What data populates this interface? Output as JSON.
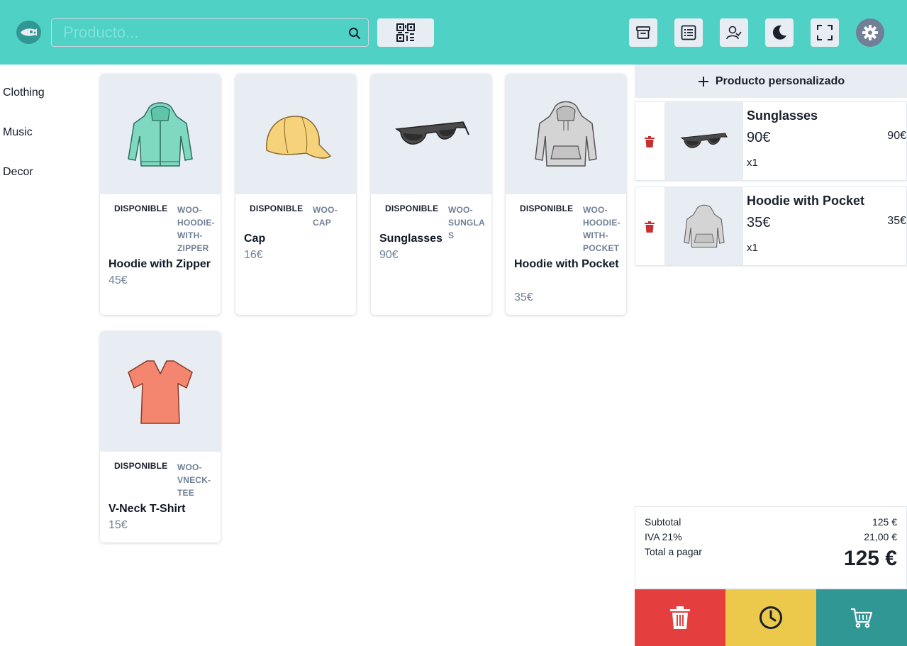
{
  "header": {
    "search_placeholder": "Producto...",
    "icons": [
      "logo-icon",
      "search-icon",
      "qr-code-icon",
      "box-icon",
      "list-icon",
      "customers-icon",
      "moon-icon",
      "fullscreen-icon",
      "gear-icon"
    ]
  },
  "categories": [
    "Clothing",
    "Music",
    "Decor"
  ],
  "products": [
    {
      "status": "DISPONIBLE",
      "sku": "WOO-HOODIE-WITH-ZIPPER",
      "name": "Hoodie with Zipper",
      "price": "45€"
    },
    {
      "status": "DISPONIBLE",
      "sku": "WOO-CAP",
      "name": "Cap",
      "price": "16€"
    },
    {
      "status": "DISPONIBLE",
      "sku": "WOO-SUNGLASSES",
      "name": "Sunglasses",
      "price": "90€"
    },
    {
      "status": "DISPONIBLE",
      "sku": "WOO-HOODIE-WITH-POCKET",
      "name": "Hoodie with Pocket",
      "price": "35€"
    },
    {
      "status": "DISPONIBLE",
      "sku": "WOO-VNECK-TEE",
      "name": "V-Neck T-Shirt",
      "price": "15€"
    }
  ],
  "sku_display": {
    "p0": [
      "WOO-",
      "HOODIE-",
      "WITH-",
      "ZIPPER"
    ],
    "p1": [
      "WOO-",
      "CAP"
    ],
    "p2": [
      "WOO-",
      "SUNGLAS"
    ],
    "p3": [
      "WOO-",
      "HOODIE-",
      "WITH-",
      "POCKET"
    ],
    "p4": [
      "WOO-",
      "VNECK-",
      "TEE"
    ]
  },
  "cart": {
    "custom_product_label": "Producto personalizado",
    "items": [
      {
        "name": "Sunglasses",
        "price": "90€",
        "qty": "x1",
        "total": "90€"
      },
      {
        "name": "Hoodie with Pocket",
        "price": "35€",
        "qty": "x1",
        "total": "35€"
      }
    ]
  },
  "totals": {
    "subtotal_label": "Subtotal",
    "subtotal_value": "125 €",
    "tax_label": "IVA 21%",
    "tax_value": "21,00 €",
    "total_label": "Total a pagar",
    "total_value": "125 €"
  },
  "colors": {
    "header": "#4fd1c5",
    "clear_button": "#e53e3e",
    "park_button": "#ecc94b",
    "checkout_button": "#319795"
  }
}
